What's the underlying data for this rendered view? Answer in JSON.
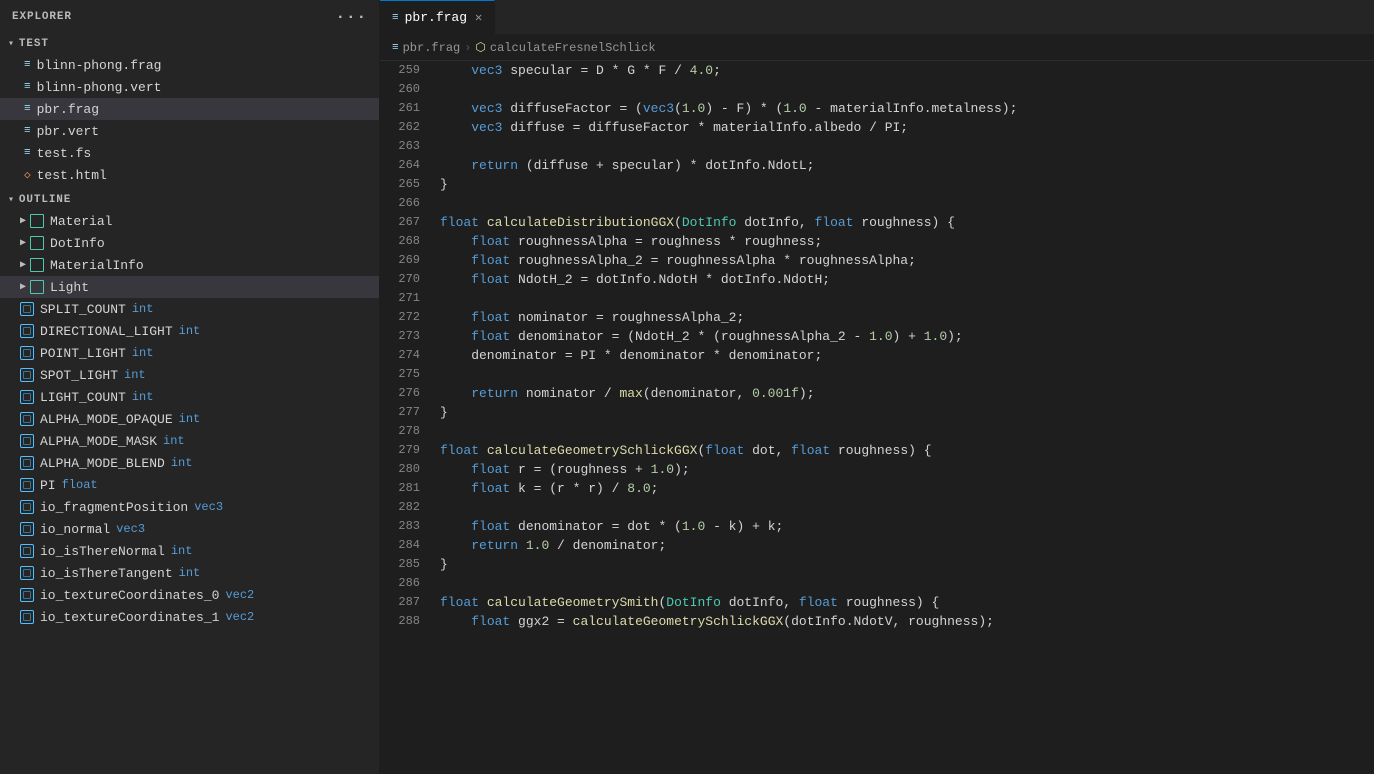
{
  "sidebar": {
    "explorer_label": "EXPLORER",
    "test_section": "TEST",
    "files": [
      {
        "name": "blinn-phong.frag",
        "icon": "frag",
        "active": false
      },
      {
        "name": "blinn-phong.vert",
        "icon": "vert",
        "active": false
      },
      {
        "name": "pbr.frag",
        "icon": "frag",
        "active": true
      },
      {
        "name": "pbr.vert",
        "icon": "vert",
        "active": false
      },
      {
        "name": "test.fs",
        "icon": "frag",
        "active": false
      },
      {
        "name": "test.html",
        "icon": "html",
        "active": false
      }
    ],
    "outline_label": "OUTLINE",
    "outline_items": [
      {
        "name": "Material",
        "type": "struct",
        "children": false
      },
      {
        "name": "DotInfo",
        "type": "struct",
        "children": false
      },
      {
        "name": "MaterialInfo",
        "type": "struct",
        "children": false
      },
      {
        "name": "Light",
        "type": "struct",
        "children": false
      },
      {
        "name": "SPLIT_COUNT",
        "type": "var",
        "typelabel": "int",
        "children": false
      },
      {
        "name": "DIRECTIONAL_LIGHT",
        "type": "var",
        "typelabel": "int",
        "children": false
      },
      {
        "name": "POINT_LIGHT",
        "type": "var",
        "typelabel": "int",
        "children": false
      },
      {
        "name": "SPOT_LIGHT",
        "type": "var",
        "typelabel": "int",
        "children": false
      },
      {
        "name": "LIGHT_COUNT",
        "type": "var",
        "typelabel": "int",
        "children": false
      },
      {
        "name": "ALPHA_MODE_OPAQUE",
        "type": "var",
        "typelabel": "int",
        "children": false
      },
      {
        "name": "ALPHA_MODE_MASK",
        "type": "var",
        "typelabel": "int",
        "children": false
      },
      {
        "name": "ALPHA_MODE_BLEND",
        "type": "var",
        "typelabel": "int",
        "children": false
      },
      {
        "name": "PI",
        "type": "var",
        "typelabel": "float",
        "children": false
      },
      {
        "name": "io_fragmentPosition",
        "type": "var",
        "typelabel": "vec3",
        "children": false
      },
      {
        "name": "io_normal",
        "type": "var",
        "typelabel": "vec3",
        "children": false
      },
      {
        "name": "io_isThereNormal",
        "type": "var",
        "typelabel": "int",
        "children": false
      },
      {
        "name": "io_isThereTangent",
        "type": "var",
        "typelabel": "int",
        "children": false
      },
      {
        "name": "io_textureCoordinates_0",
        "type": "var",
        "typelabel": "vec2",
        "children": false
      },
      {
        "name": "io_textureCoordinates_1",
        "type": "var",
        "typelabel": "vec2",
        "children": false
      }
    ]
  },
  "tab": {
    "filename": "pbr.frag",
    "modified": false
  },
  "breadcrumb": {
    "file": "pbr.frag",
    "func": "calculateFresnelSchlick"
  },
  "code": {
    "lines": [
      {
        "num": "259",
        "tokens": [
          {
            "t": "    vec3 specular = D * G * F / 4.0;",
            "c": "plain"
          }
        ]
      },
      {
        "num": "260",
        "tokens": [
          {
            "t": "",
            "c": "plain"
          }
        ]
      },
      {
        "num": "261",
        "tokens": [
          {
            "t": "    vec3 diffuseFactor = (vec3(1.0) - F) * (1.0 - materialInfo.metalness);",
            "c": "plain"
          }
        ]
      },
      {
        "num": "262",
        "tokens": [
          {
            "t": "    vec3 diffuse = diffuseFactor * materialInfo.albedo / PI;",
            "c": "plain"
          }
        ]
      },
      {
        "num": "263",
        "tokens": [
          {
            "t": "",
            "c": "plain"
          }
        ]
      },
      {
        "num": "264",
        "tokens": [
          {
            "t": "    return (diffuse + specular) * dotInfo.NdotL;",
            "c": "plain"
          }
        ]
      },
      {
        "num": "265",
        "tokens": [
          {
            "t": "}",
            "c": "plain"
          }
        ]
      },
      {
        "num": "266",
        "tokens": [
          {
            "t": "",
            "c": "plain"
          }
        ]
      },
      {
        "num": "267",
        "tokens": [
          {
            "t": "float calculateDistributionGGX(DotInfo dotInfo, float roughness) {",
            "c": "plain"
          }
        ]
      },
      {
        "num": "268",
        "tokens": [
          {
            "t": "    float roughnessAlpha = roughness * roughness;",
            "c": "plain"
          }
        ]
      },
      {
        "num": "269",
        "tokens": [
          {
            "t": "    float roughnessAlpha_2 = roughnessAlpha * roughnessAlpha;",
            "c": "plain"
          }
        ]
      },
      {
        "num": "270",
        "tokens": [
          {
            "t": "    float NdotH_2 = dotInfo.NdotH * dotInfo.NdotH;",
            "c": "plain"
          }
        ]
      },
      {
        "num": "271",
        "tokens": [
          {
            "t": "",
            "c": "plain"
          }
        ]
      },
      {
        "num": "272",
        "tokens": [
          {
            "t": "    float nominator = roughnessAlpha_2;",
            "c": "plain"
          }
        ]
      },
      {
        "num": "273",
        "tokens": [
          {
            "t": "    float denominator = (NdotH_2 * (roughnessAlpha_2 - 1.0) + 1.0);",
            "c": "plain"
          }
        ]
      },
      {
        "num": "274",
        "tokens": [
          {
            "t": "    denominator = PI * denominator * denominator;",
            "c": "plain"
          }
        ]
      },
      {
        "num": "275",
        "tokens": [
          {
            "t": "",
            "c": "plain"
          }
        ]
      },
      {
        "num": "276",
        "tokens": [
          {
            "t": "    return nominator / max(denominator, 0.001f);",
            "c": "plain"
          }
        ]
      },
      {
        "num": "277",
        "tokens": [
          {
            "t": "}",
            "c": "plain"
          }
        ]
      },
      {
        "num": "278",
        "tokens": [
          {
            "t": "",
            "c": "plain"
          }
        ]
      },
      {
        "num": "279",
        "tokens": [
          {
            "t": "float calculateGeometrySchlickGGX(float dot, float roughness) {",
            "c": "plain"
          }
        ]
      },
      {
        "num": "280",
        "tokens": [
          {
            "t": "    float r = (roughness + 1.0);",
            "c": "plain"
          }
        ]
      },
      {
        "num": "281",
        "tokens": [
          {
            "t": "    float k = (r * r) / 8.0;",
            "c": "plain"
          }
        ]
      },
      {
        "num": "282",
        "tokens": [
          {
            "t": "",
            "c": "plain"
          }
        ]
      },
      {
        "num": "283",
        "tokens": [
          {
            "t": "    float denominator = dot * (1.0 - k) + k;",
            "c": "plain"
          }
        ]
      },
      {
        "num": "284",
        "tokens": [
          {
            "t": "    return 1.0 / denominator;",
            "c": "plain"
          }
        ]
      },
      {
        "num": "285",
        "tokens": [
          {
            "t": "}",
            "c": "plain"
          }
        ]
      },
      {
        "num": "286",
        "tokens": [
          {
            "t": "",
            "c": "plain"
          }
        ]
      },
      {
        "num": "287",
        "tokens": [
          {
            "t": "float calculateGeometrySmith(DotInfo dotInfo, float roughness) {",
            "c": "plain"
          }
        ]
      },
      {
        "num": "288",
        "tokens": [
          {
            "t": "    float ggx2 = calculateGeometrySchlickGGX(dotInfo.NdotV, roughness);",
            "c": "plain"
          }
        ]
      }
    ]
  }
}
